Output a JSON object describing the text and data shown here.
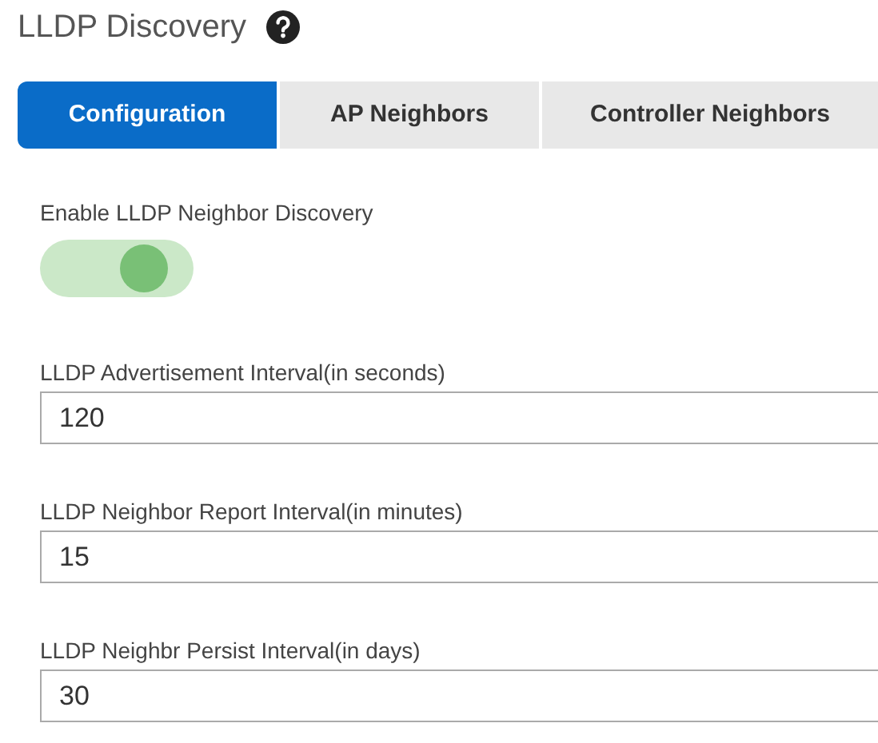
{
  "title": "LLDP Discovery",
  "tabs": [
    {
      "label": "Configuration",
      "selected": true
    },
    {
      "label": "AP Neighbors",
      "selected": false
    },
    {
      "label": "Controller Neighbors",
      "selected": false
    }
  ],
  "toggle": {
    "label": "Enable LLDP Neighbor Discovery",
    "on": true
  },
  "fields": [
    {
      "label": "LLDP Advertisement Interval(in seconds)",
      "value": "120"
    },
    {
      "label": "LLDP Neighbor Report Interval(in minutes)",
      "value": "15"
    },
    {
      "label": "LLDP Neighbr Persist Interval(in days)",
      "value": "30"
    }
  ]
}
